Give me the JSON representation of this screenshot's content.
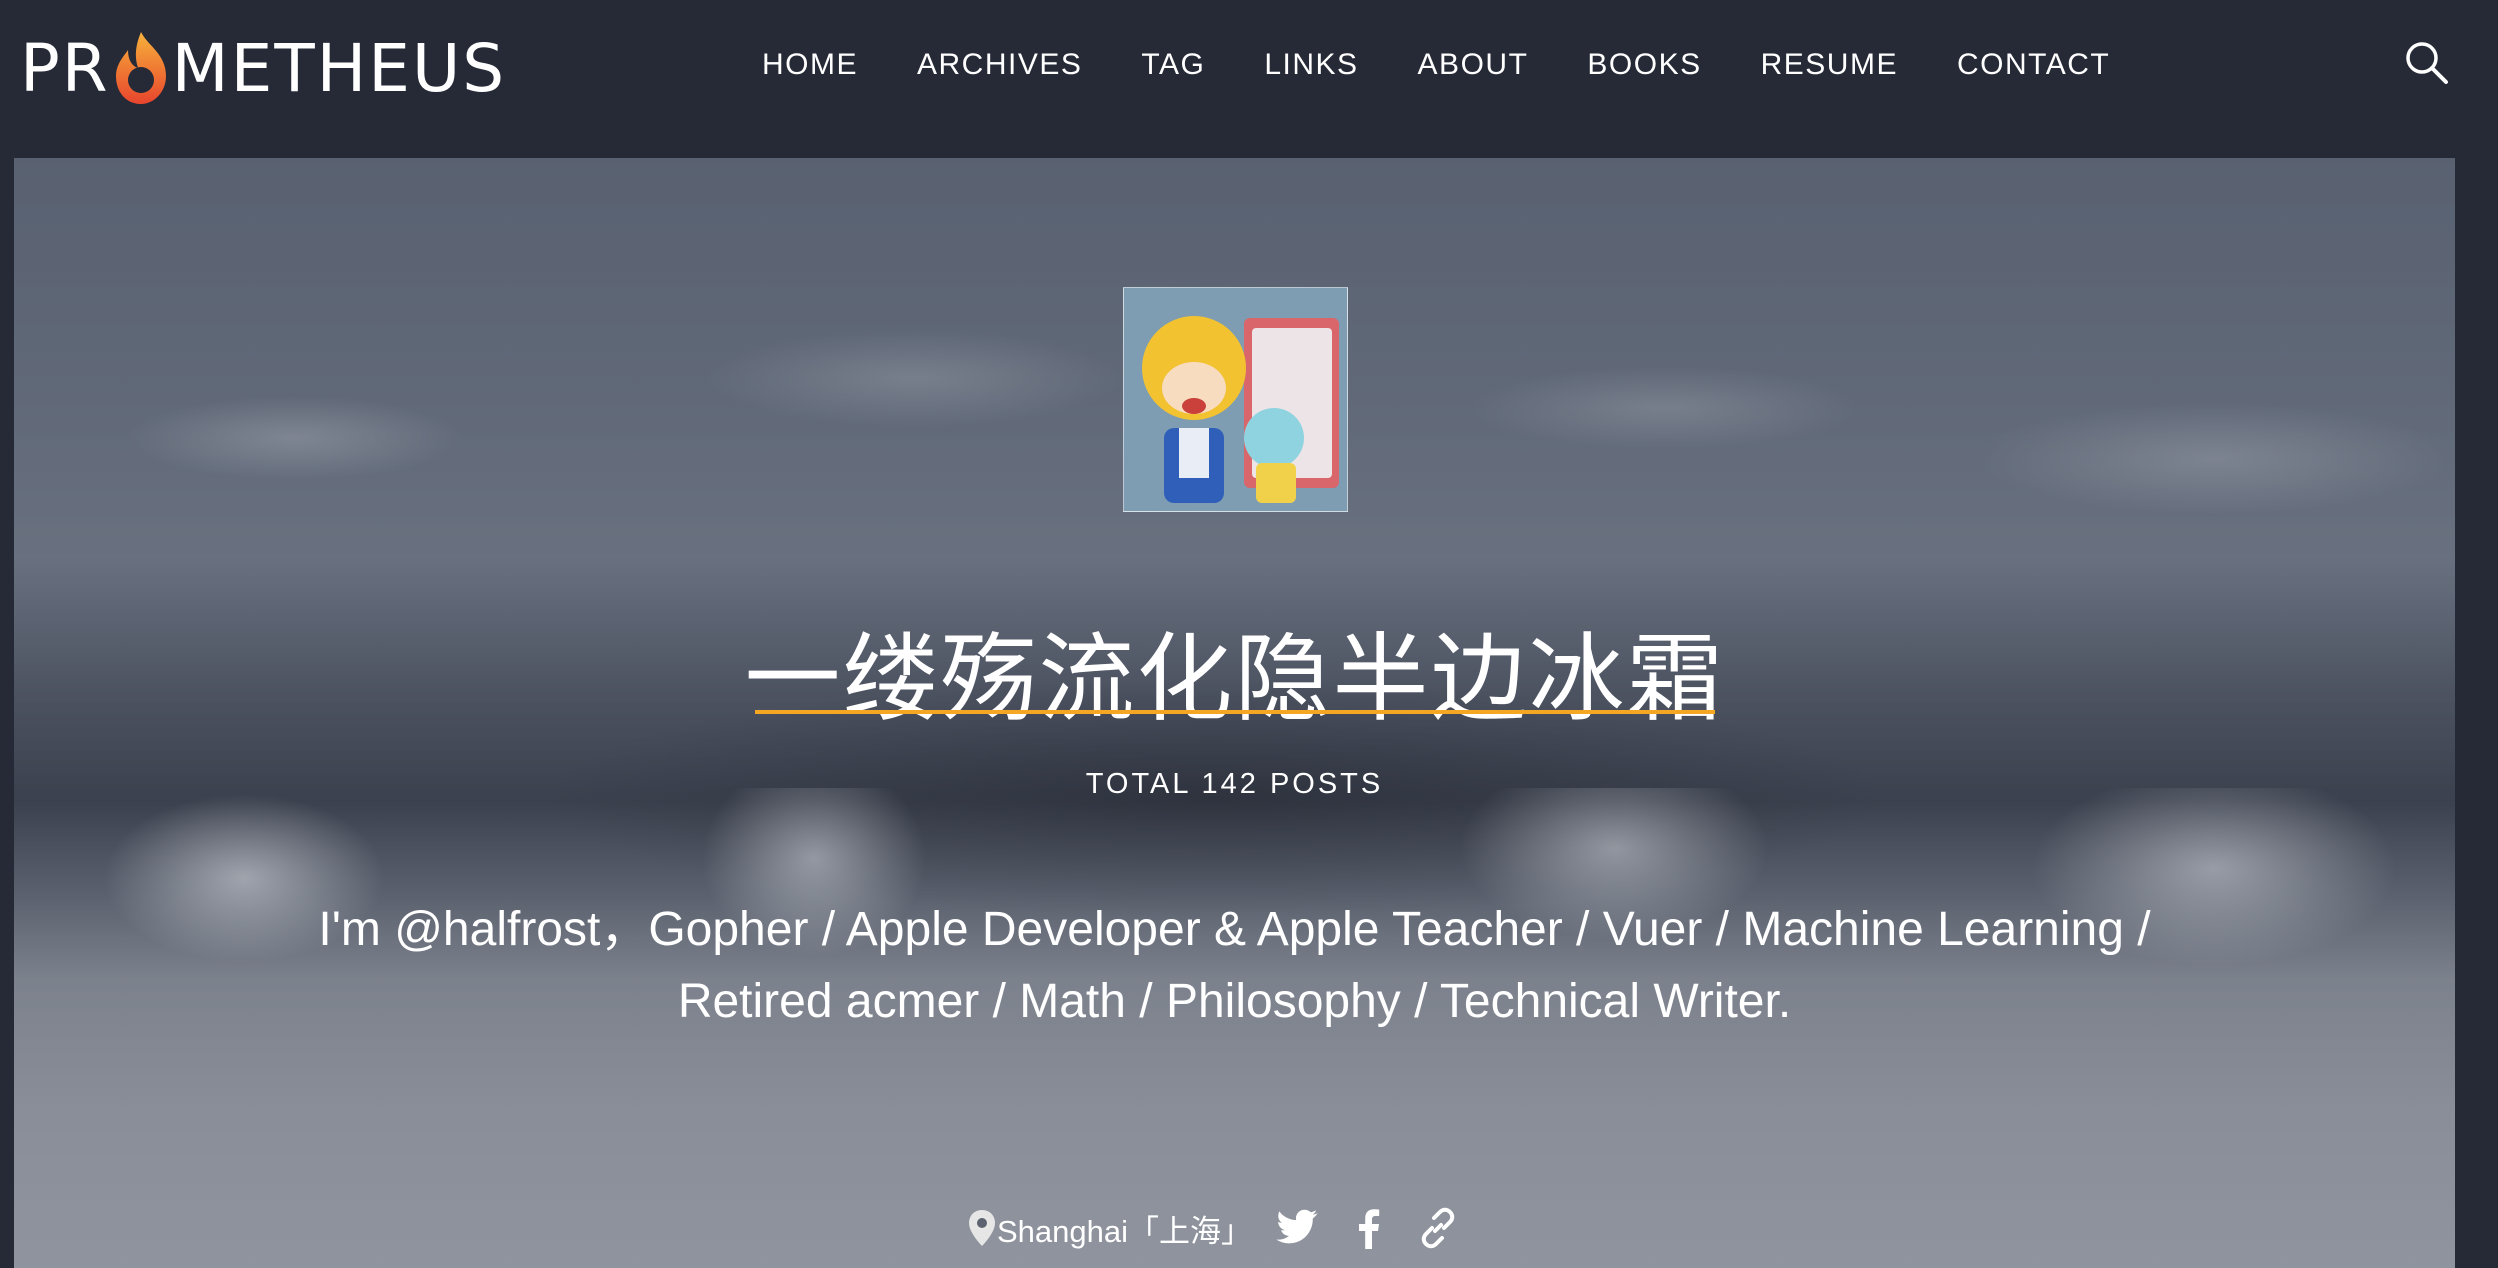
{
  "header": {
    "logo_text": "PROMETHEUS",
    "nav": [
      {
        "label": "HOME"
      },
      {
        "label": "ARCHIVES"
      },
      {
        "label": "TAG"
      },
      {
        "label": "LINKS"
      },
      {
        "label": "ABOUT"
      },
      {
        "label": "BOOKS"
      },
      {
        "label": "RESUME"
      },
      {
        "label": "CONTACT"
      }
    ],
    "search_icon": "search-icon"
  },
  "hero": {
    "title": "一缕殇流化隐半边冰霜",
    "post_count": "TOTAL 142 POSTS",
    "bio": "I'm @halfrost，Gopher / Apple Developer & Apple Teacher / Vuer / Machine Learning / Retired acmer / Math / Philosophy / Technical Writer.",
    "location": "Shanghai「上海」",
    "social_icons": [
      "twitter-icon",
      "facebook-icon",
      "link-icon"
    ],
    "accent_color": "#f5a623"
  },
  "colors": {
    "topbar": "#262a37",
    "text": "#ffffff"
  }
}
